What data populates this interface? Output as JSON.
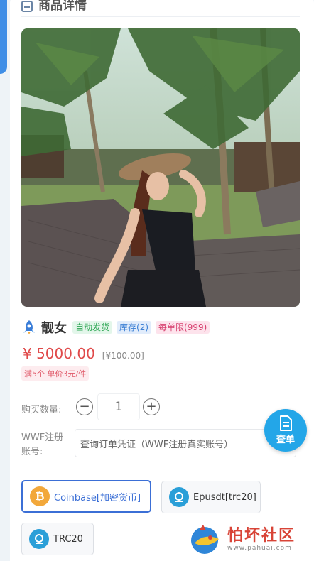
{
  "header": {
    "title": "商品详情"
  },
  "product": {
    "name": "靓女",
    "tags": [
      "自动发货",
      "库存(2)",
      "每单限(999)"
    ],
    "price": "¥ 5000.00",
    "original_price": "¥100.00",
    "discount": "满5个 单价3元/件"
  },
  "quantity": {
    "label": "购买数量:",
    "value": "1"
  },
  "form": {
    "label": "WWF注册账号:",
    "placeholder": "查询订单凭证（WWF注册真实账号）"
  },
  "fab": {
    "label": "查单"
  },
  "payments": [
    {
      "label": "Coinbase[加密货币]",
      "selected": true,
      "icon": "bitcoin-icon",
      "color": "#f2a83b"
    },
    {
      "label": "Epusdt[trc20]",
      "selected": false,
      "icon": "epusdt-icon",
      "color": "#2a9fd8"
    },
    {
      "label": "TRC20",
      "selected": false,
      "icon": "trc20-icon",
      "color": "#2a9fd8"
    }
  ],
  "watermark": {
    "title": "怕坏社区",
    "url": "www.pahuai.com"
  },
  "colors": {
    "accent": "#3b6fd6",
    "price": "#e04a4a",
    "fab": "#23a6e8"
  }
}
